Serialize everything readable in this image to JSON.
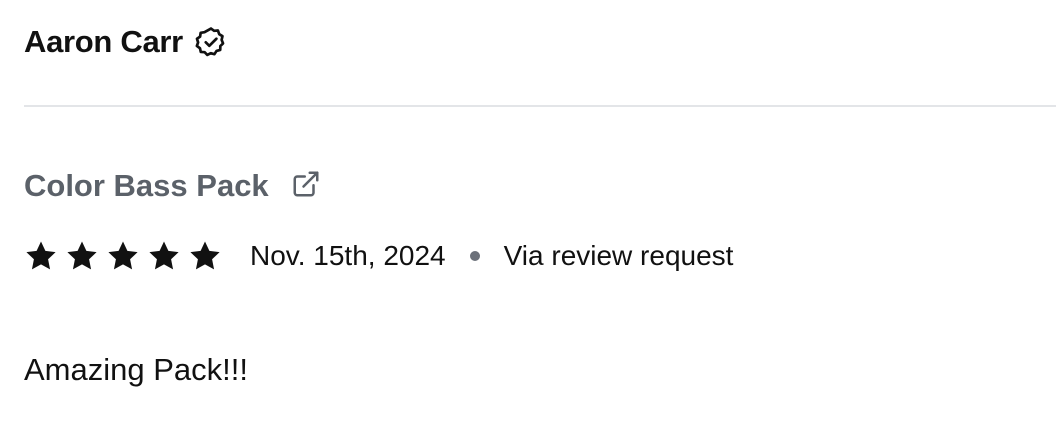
{
  "review": {
    "author": {
      "name": "Aaron Carr",
      "verified_icon": "verified-badge-icon"
    },
    "product": {
      "name": "Color Bass Pack",
      "link_icon": "external-link-icon"
    },
    "rating": {
      "stars": 5,
      "max_stars": 5
    },
    "date": "Nov. 15th, 2024",
    "source": "Via review request",
    "body": "Amazing Pack!!!"
  },
  "colors": {
    "text": "#111111",
    "product_link": "#5b6169",
    "divider": "#e3e5e8",
    "star": "#111111",
    "dot": "#6b7079"
  }
}
